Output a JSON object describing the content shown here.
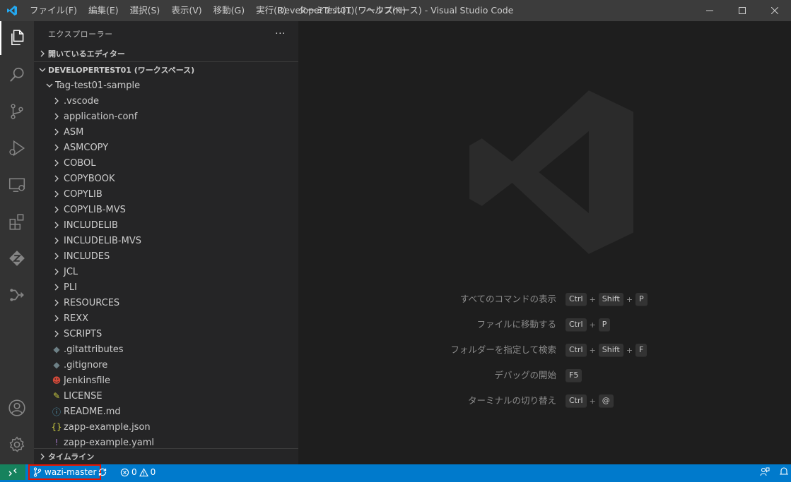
{
  "titlebar": {
    "menu": [
      "ファイル(F)",
      "編集(E)",
      "選択(S)",
      "表示(V)",
      "移動(G)",
      "実行(R)",
      "ターミナル(T)",
      "ヘルプ(H)"
    ],
    "title": "DeveloperTest01 (ワークスペース) - Visual Studio Code"
  },
  "sidebar": {
    "header": "エクスプローラー",
    "more": "···",
    "open_editors": "開いているエディター",
    "workspace": "DEVELOPERTEST01 (ワークスペース)",
    "root_folder": "Tag-test01-sample",
    "folders": [
      ".vscode",
      "application-conf",
      "ASM",
      "ASMCOPY",
      "COBOL",
      "COPYBOOK",
      "COPYLIB",
      "COPYLIB-MVS",
      "INCLUDELIB",
      "INCLUDELIB-MVS",
      "INCLUDES",
      "JCL",
      "PLI",
      "RESOURCES",
      "REXX",
      "SCRIPTS"
    ],
    "files": [
      {
        "name": ".gitattributes",
        "icon": "git-icon",
        "glyph": "◆",
        "color": "#6d8086"
      },
      {
        "name": ".gitignore",
        "icon": "git-icon",
        "glyph": "◆",
        "color": "#6d8086"
      },
      {
        "name": "Jenkinsfile",
        "icon": "jenkins-icon",
        "glyph": "☻",
        "color": "#d24939"
      },
      {
        "name": "LICENSE",
        "icon": "license-icon",
        "glyph": "✎",
        "color": "#cbcb41"
      },
      {
        "name": "README.md",
        "icon": "info-icon",
        "glyph": "ⓘ",
        "color": "#519aba"
      },
      {
        "name": "zapp-example.json",
        "icon": "json-icon",
        "glyph": "{}",
        "color": "#cbcb41"
      },
      {
        "name": "zapp-example.yaml",
        "icon": "yaml-icon",
        "glyph": "!",
        "color": "#a074c4"
      }
    ],
    "timeline": "タイムライン"
  },
  "editor": {
    "shortcuts": [
      {
        "label": "すべてのコマンドの表示",
        "keys": [
          "Ctrl",
          "Shift",
          "P"
        ]
      },
      {
        "label": "ファイルに移動する",
        "keys": [
          "Ctrl",
          "P"
        ]
      },
      {
        "label": "フォルダーを指定して検索",
        "keys": [
          "Ctrl",
          "Shift",
          "F"
        ]
      },
      {
        "label": "デバッグの開始",
        "keys": [
          "F5"
        ]
      },
      {
        "label": "ターミナルの切り替え",
        "keys": [
          "Ctrl",
          "@"
        ]
      }
    ]
  },
  "statusbar": {
    "branch": "wazi-master",
    "errors": "0",
    "warnings": "0"
  },
  "colors": {
    "accent": "#007acc",
    "remote": "#16825d",
    "highlight": "#e51400"
  }
}
